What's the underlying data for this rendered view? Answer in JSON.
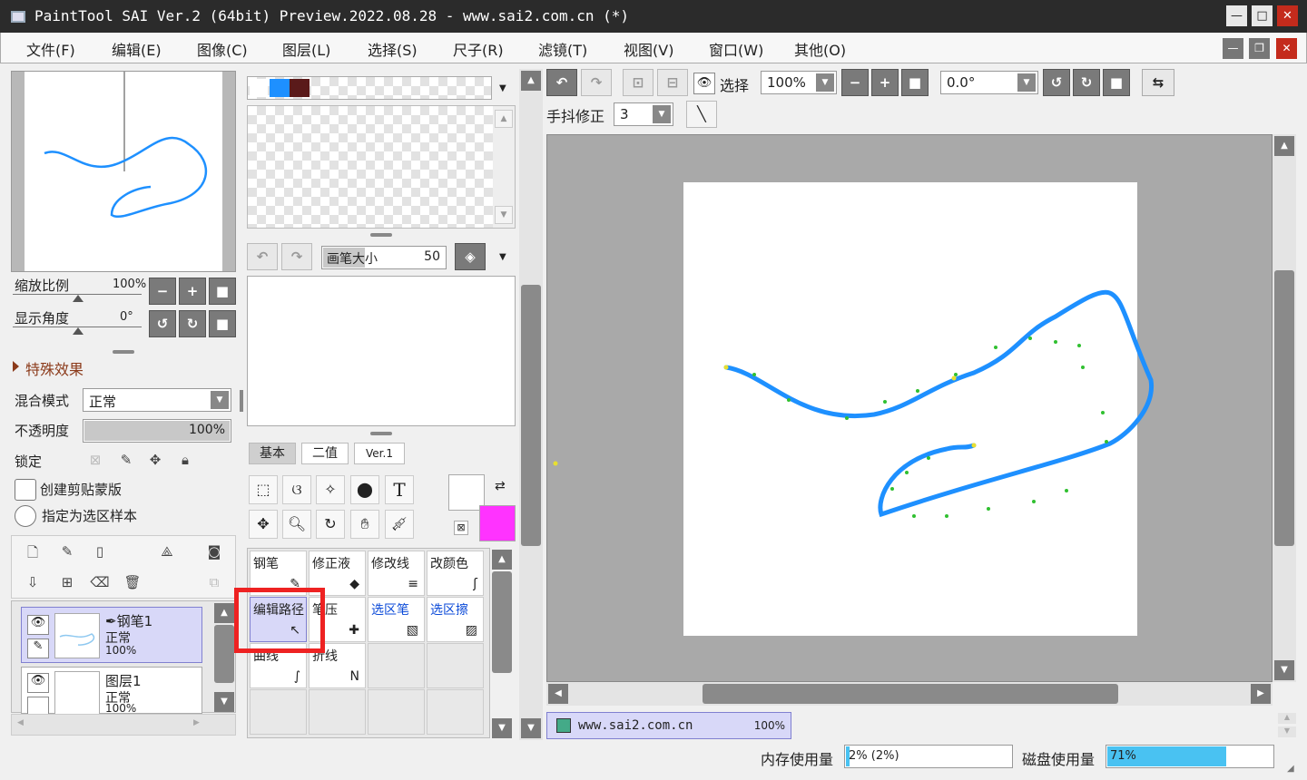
{
  "window": {
    "title": "PaintTool SAI Ver.2 (64bit) Preview.2022.08.28 - www.sai2.com.cn (*)",
    "minimize": "—",
    "maximize": "□",
    "close": "✕"
  },
  "menu": [
    "文件(F)",
    "编辑(E)",
    "图像(C)",
    "图层(L)",
    "选择(S)",
    "尺子(R)",
    "滤镜(T)",
    "视图(V)",
    "窗口(W)",
    "其他(O)"
  ],
  "navigator": {
    "zoom_label": "缩放比例",
    "zoom_value": "100%",
    "angle_label": "显示角度",
    "angle_value": "0°"
  },
  "effects": {
    "label": "特殊效果"
  },
  "layer_props": {
    "blend_label": "混合模式",
    "blend_value": "正常",
    "opacity_label": "不透明度",
    "opacity_value": "100%",
    "opacity_level": 1.0,
    "lock_label": "锁定",
    "clip_label": "创建剪贴蒙版",
    "sample_label": "指定为选区样本"
  },
  "layers": [
    {
      "name": "钢笔1",
      "mode": "正常",
      "opacity": "100%",
      "selected": true
    },
    {
      "name": "图层1",
      "mode": "正常",
      "opacity": "100%",
      "selected": false
    }
  ],
  "colors": {
    "swatch1": "#1e90ff",
    "swatch2": "#5a1a1a",
    "primary": "#ffffff",
    "secondary": "#ff33ff",
    "accent": "#1e90ff",
    "stroke": "#1e90ff"
  },
  "brush": {
    "size_label": "画笔大小",
    "size_value": "50"
  },
  "tool_tabs": [
    "基本",
    "二值",
    "Ver.1"
  ],
  "tools": [
    {
      "label": "钢笔",
      "icon": "✎",
      "blue": false
    },
    {
      "label": "修正液",
      "icon": "◆",
      "blue": false
    },
    {
      "label": "修改线",
      "icon": "≡",
      "blue": false
    },
    {
      "label": "改颜色",
      "icon": "ʃ",
      "blue": false
    },
    {
      "label": "编辑路径",
      "icon": "↖",
      "blue": false
    },
    {
      "label": "笔压",
      "icon": "✚",
      "blue": false
    },
    {
      "label": "选区笔",
      "icon": "▧",
      "blue": true
    },
    {
      "label": "选区擦",
      "icon": "▨",
      "blue": true
    },
    {
      "label": "曲线",
      "icon": "∫",
      "blue": false
    },
    {
      "label": "折线",
      "icon": "N",
      "blue": false
    }
  ],
  "canvas_toolbar": {
    "select_label": "选择",
    "zoom_value": "100%",
    "angle_value": "0.0°",
    "stabilizer_label": "手抖修正",
    "stabilizer_value": "3"
  },
  "tab": {
    "name": "www.sai2.com.cn",
    "zoom": "100%"
  },
  "status": {
    "memory_label": "内存使用量",
    "memory_value": "2% (2%)",
    "memory_level": 0.02,
    "disk_label": "磁盘使用量",
    "disk_value": "71%",
    "disk_level": 0.71
  }
}
